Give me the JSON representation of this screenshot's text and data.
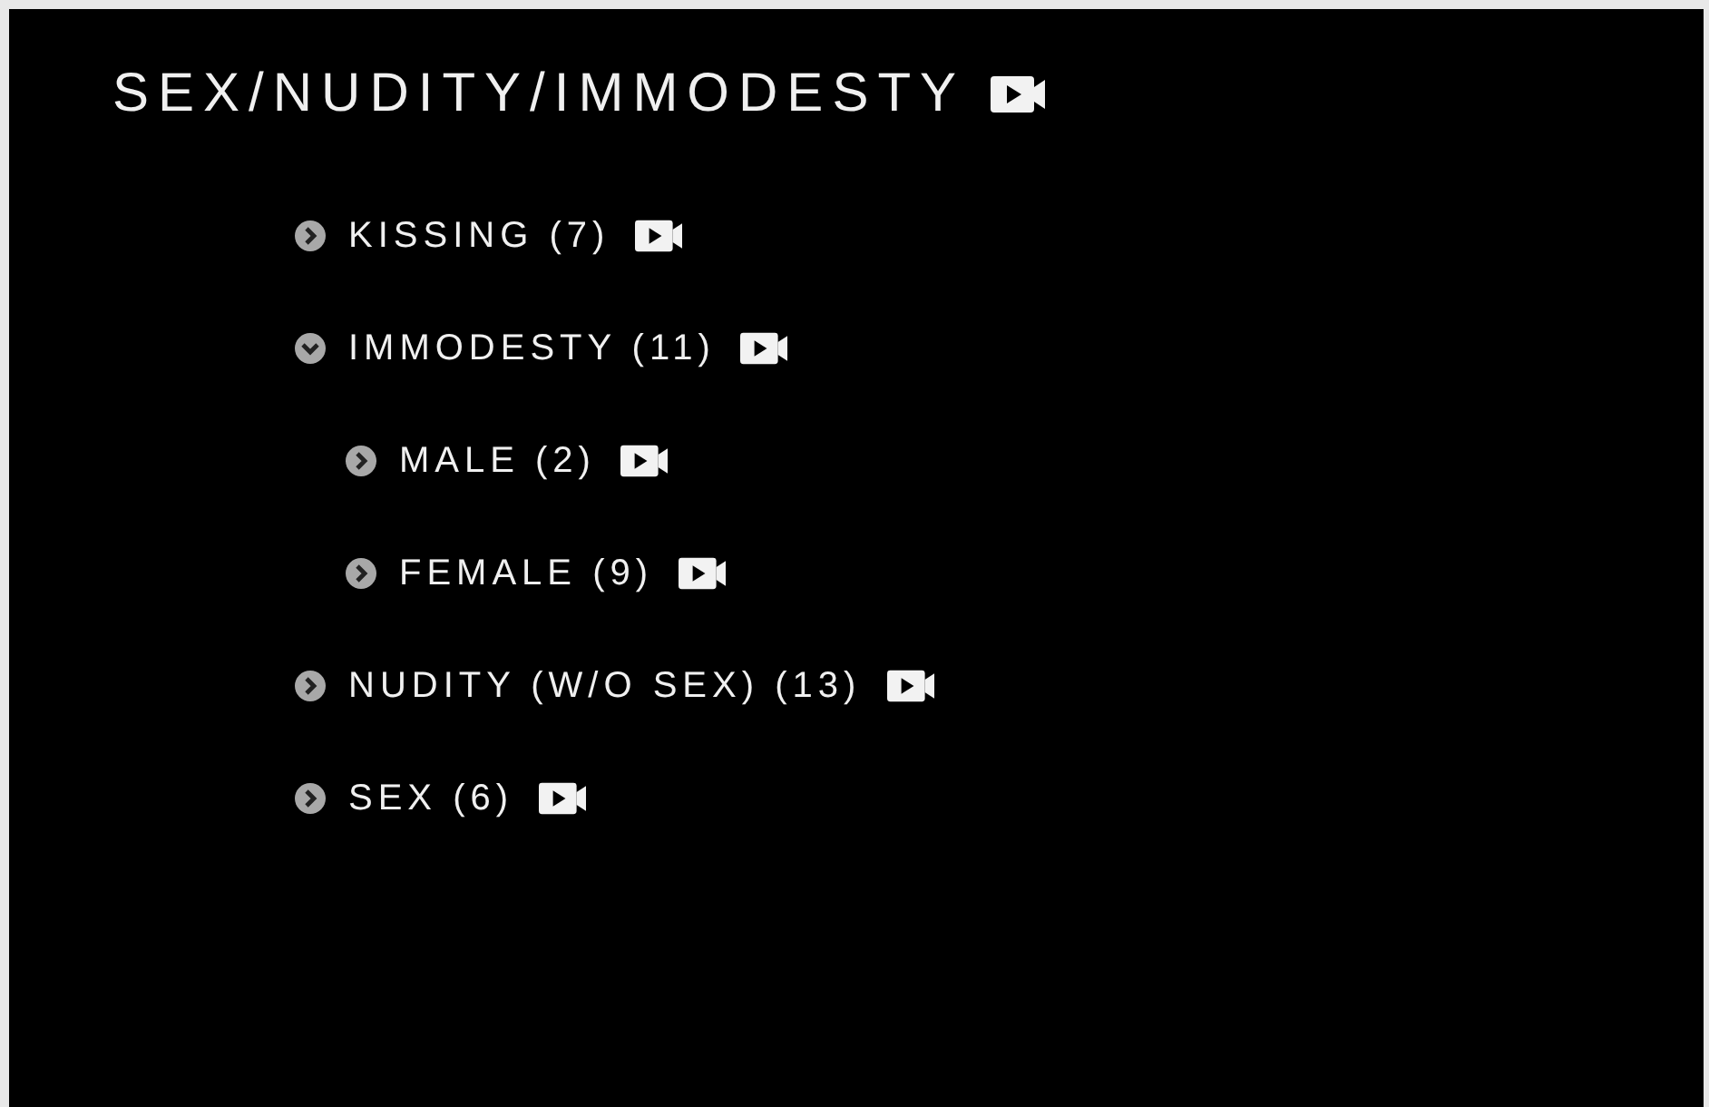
{
  "title": "SEX/NUDITY/IMMODESTY",
  "items": [
    {
      "label": "KISSING (7)",
      "expanded": false
    },
    {
      "label": "IMMODESTY (11)",
      "expanded": true,
      "children": [
        {
          "label": "MALE (2)",
          "expanded": false
        },
        {
          "label": "FEMALE (9)",
          "expanded": false
        }
      ]
    },
    {
      "label": "NUDITY (W/O SEX) (13)",
      "expanded": false
    },
    {
      "label": "SEX (6)",
      "expanded": false
    }
  ]
}
